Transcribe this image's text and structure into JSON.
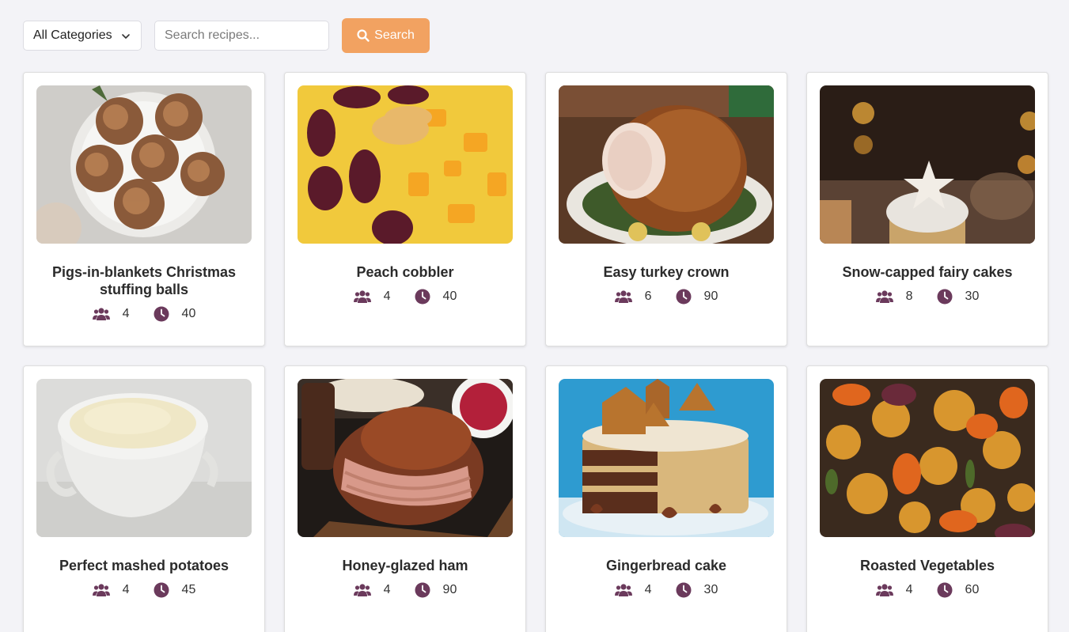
{
  "toolbar": {
    "category_selected": "All Categories",
    "search_placeholder": "Search recipes...",
    "search_label": "Search"
  },
  "colors": {
    "accent": "#f2a261",
    "icon": "#6b3a5c",
    "background": "#f3f3f7"
  },
  "recipes": [
    {
      "title": "Pigs-in-blankets Christmas stuffing balls",
      "servings": "4",
      "time": "40",
      "image": "stuffing-balls-photo"
    },
    {
      "title": "Peach cobbler",
      "servings": "4",
      "time": "40",
      "image": "peach-cobbler-photo"
    },
    {
      "title": "Easy turkey crown",
      "servings": "6",
      "time": "90",
      "image": "turkey-crown-photo"
    },
    {
      "title": "Snow-capped fairy cakes",
      "servings": "8",
      "time": "30",
      "image": "fairy-cakes-photo"
    },
    {
      "title": "Perfect mashed potatoes",
      "servings": "4",
      "time": "45",
      "image": "mashed-potatoes-photo"
    },
    {
      "title": "Honey-glazed ham",
      "servings": "4",
      "time": "90",
      "image": "honey-ham-photo"
    },
    {
      "title": "Gingerbread cake",
      "servings": "4",
      "time": "30",
      "image": "gingerbread-cake-photo"
    },
    {
      "title": "Roasted Vegetables",
      "servings": "4",
      "time": "60",
      "image": "roasted-vegetables-photo"
    }
  ]
}
